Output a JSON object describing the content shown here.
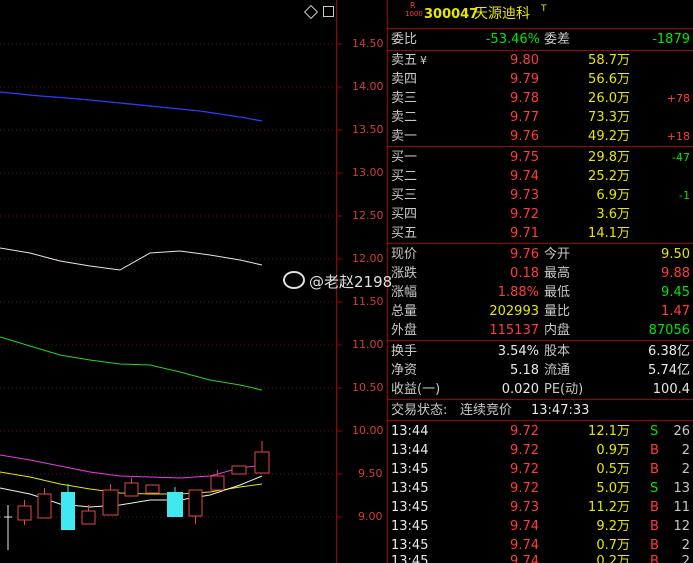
{
  "header": {
    "badge_top": "R",
    "badge_bottom": "1000",
    "code": "300047",
    "name": "天源迪科",
    "flag": "T",
    "corner_icon": "diamond-icon"
  },
  "price_axis": {
    "ticks": [
      "14.50",
      "14.00",
      "13.50",
      "13.00",
      "12.50",
      "12.00",
      "11.50",
      "11.00",
      "10.50",
      "10.00",
      "9.50",
      "9.00"
    ]
  },
  "weibi": {
    "label1": "委比",
    "value1": "-53.46%",
    "label2": "委差",
    "value2": "-1879"
  },
  "sell": [
    {
      "label": "卖五",
      "mark": "¥",
      "price": "9.80",
      "vol": "58.7",
      "unit": "万",
      "chg": ""
    },
    {
      "label": "卖四",
      "mark": "",
      "price": "9.79",
      "vol": "56.6",
      "unit": "万",
      "chg": ""
    },
    {
      "label": "卖三",
      "mark": "",
      "price": "9.78",
      "vol": "26.0",
      "unit": "万",
      "chg": "+78"
    },
    {
      "label": "卖二",
      "mark": "",
      "price": "9.77",
      "vol": "73.3",
      "unit": "万",
      "chg": ""
    },
    {
      "label": "卖一",
      "mark": "",
      "price": "9.76",
      "vol": "49.2",
      "unit": "万",
      "chg": "+18"
    }
  ],
  "buy": [
    {
      "label": "买一",
      "price": "9.75",
      "vol": "29.8",
      "unit": "万",
      "chg": "-47"
    },
    {
      "label": "买二",
      "price": "9.74",
      "vol": "25.2",
      "unit": "万",
      "chg": ""
    },
    {
      "label": "买三",
      "price": "9.73",
      "vol": "6.9",
      "unit": "万",
      "chg": "-1"
    },
    {
      "label": "买四",
      "price": "9.72",
      "vol": "3.6",
      "unit": "万",
      "chg": ""
    },
    {
      "label": "买五",
      "price": "9.71",
      "vol": "14.1",
      "unit": "万",
      "chg": ""
    }
  ],
  "quote": {
    "r1": {
      "l1": "现价",
      "v1": "9.76",
      "l2": "今开",
      "v2": "9.50"
    },
    "r2": {
      "l1": "涨跌",
      "v1": "0.18",
      "l2": "最高",
      "v2": "9.88"
    },
    "r3": {
      "l1": "涨幅",
      "v1": "1.88%",
      "l2": "最低",
      "v2": "9.45"
    },
    "r4": {
      "l1": "总量",
      "v1": "202993",
      "l2": "量比",
      "v2": "1.47"
    },
    "r5": {
      "l1": "外盘",
      "v1": "115137",
      "l2": "内盘",
      "v2": "87056"
    }
  },
  "stats": {
    "r1": {
      "l1": "换手",
      "v1": "3.54%",
      "l2": "股本",
      "v2": "6.38亿"
    },
    "r2": {
      "l1": "净资",
      "v1": "5.18",
      "l2": "流通",
      "v2": "5.74亿"
    },
    "r3": {
      "l1": "收益(一)",
      "v1": "0.020",
      "l2": "PE(动)",
      "v2": "100.4"
    }
  },
  "status": {
    "label": "交易状态:",
    "value": "连续竞价",
    "time": "13:47:33"
  },
  "ticks": [
    {
      "time": "13:44",
      "price": "9.72",
      "vol": "12.1",
      "unit": "万",
      "side": "S",
      "num": "26"
    },
    {
      "time": "13:44",
      "price": "9.72",
      "vol": "0.9",
      "unit": "万",
      "side": "B",
      "num": "2"
    },
    {
      "time": "13:45",
      "price": "9.72",
      "vol": "0.5",
      "unit": "万",
      "side": "B",
      "num": "2"
    },
    {
      "time": "13:45",
      "price": "9.72",
      "vol": "5.0",
      "unit": "万",
      "side": "S",
      "num": "13"
    },
    {
      "time": "13:45",
      "price": "9.73",
      "vol": "11.2",
      "unit": "万",
      "side": "B",
      "num": "11"
    },
    {
      "time": "13:45",
      "price": "9.74",
      "vol": "9.2",
      "unit": "万",
      "side": "B",
      "num": "12"
    },
    {
      "time": "13:45",
      "price": "9.74",
      "vol": "0.7",
      "unit": "万",
      "side": "B",
      "num": "2"
    },
    {
      "time": "13:45",
      "price": "9.74",
      "vol": "0.2",
      "unit": "万",
      "side": "B",
      "num": "2"
    }
  ],
  "watermark": "@老赵2198"
}
